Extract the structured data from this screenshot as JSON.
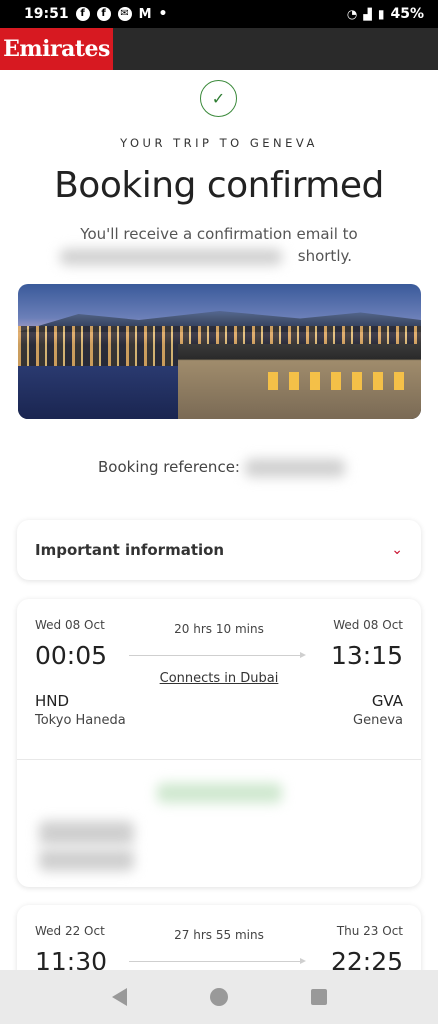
{
  "status_bar": {
    "time": "19:51",
    "battery": "45%",
    "icons": [
      "facebook-icon",
      "facebook-icon",
      "messenger-icon",
      "gmail-icon",
      "dot-icon"
    ]
  },
  "header": {
    "logo": "Emirates"
  },
  "confirmation": {
    "trip_label": "YOUR TRIP TO GENEVA",
    "title": "Booking confirmed",
    "subtitle_line1": "You'll receive a confirmation email to",
    "subtitle_line2_end": "shortly.",
    "booking_ref_label": "Booking reference:"
  },
  "important_info": {
    "label": "Important information"
  },
  "flights": [
    {
      "dep_date": "Wed 08 Oct",
      "dep_time": "00:05",
      "duration": "20 hrs 10 mins",
      "arr_date": "Wed 08 Oct",
      "arr_time": "13:15",
      "connection": "Connects in Dubai",
      "dep_code": "HND",
      "dep_city": "Tokyo Haneda",
      "arr_code": "GVA",
      "arr_city": "Geneva"
    },
    {
      "dep_date": "Wed 22 Oct",
      "dep_time": "11:30",
      "duration": "27 hrs 55 mins",
      "arr_date": "Thu 23 Oct",
      "arr_time": "22:25"
    }
  ],
  "colors": {
    "brand_red": "#d71921",
    "success_green": "#2e7d32"
  }
}
